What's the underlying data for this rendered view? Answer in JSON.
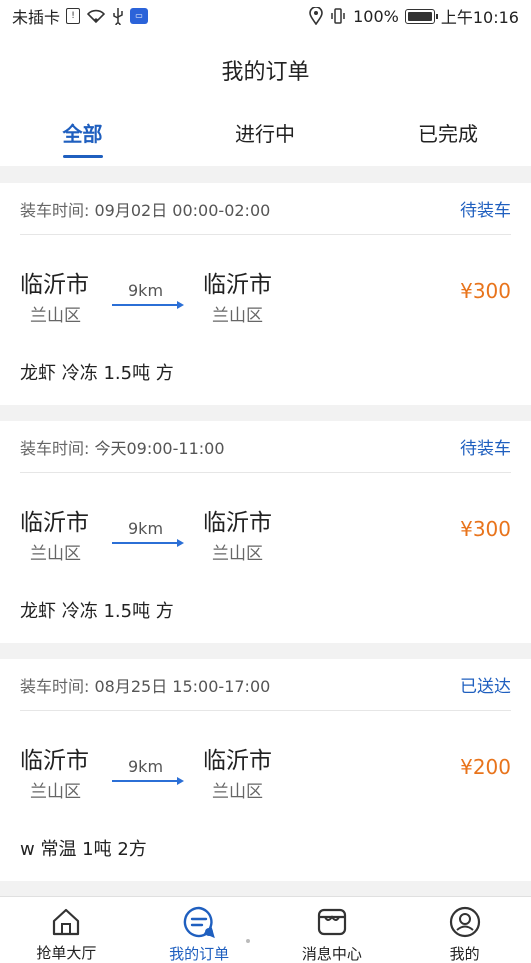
{
  "status_bar": {
    "carrier": "未插卡",
    "battery": "100%",
    "time": "上午10:16"
  },
  "header": {
    "title": "我的订单"
  },
  "tabs": [
    {
      "label": "全部",
      "active": true
    },
    {
      "label": "进行中",
      "active": false
    },
    {
      "label": "已完成",
      "active": false
    }
  ],
  "load_time_label": "装车时间:",
  "orders": [
    {
      "load_time": "09月02日 00:00-02:00",
      "status": "待装车",
      "from_city": "临沂市",
      "from_district": "兰山区",
      "to_city": "临沂市",
      "to_district": "兰山区",
      "distance": "9km",
      "price": "¥300",
      "cargo": "龙虾 冷冻 1.5吨 方"
    },
    {
      "load_time": "今天09:00-11:00",
      "status": "待装车",
      "from_city": "临沂市",
      "from_district": "兰山区",
      "to_city": "临沂市",
      "to_district": "兰山区",
      "distance": "9km",
      "price": "¥300",
      "cargo": "龙虾 冷冻 1.5吨 方"
    },
    {
      "load_time": "08月25日 15:00-17:00",
      "status": "已送达",
      "from_city": "临沂市",
      "from_district": "兰山区",
      "to_city": "临沂市",
      "to_district": "兰山区",
      "distance": "9km",
      "price": "¥200",
      "cargo": "w 常温 1吨 2方"
    }
  ],
  "bottom_nav": [
    {
      "label": "抢单大厅",
      "icon": "home-icon",
      "active": false
    },
    {
      "label": "我的订单",
      "icon": "order-chat-icon",
      "active": true
    },
    {
      "label": "消息中心",
      "icon": "shop-icon",
      "active": false
    },
    {
      "label": "我的",
      "icon": "profile-icon",
      "active": false
    }
  ],
  "colors": {
    "accent": "#1f5fbf",
    "price": "#e8741c"
  }
}
